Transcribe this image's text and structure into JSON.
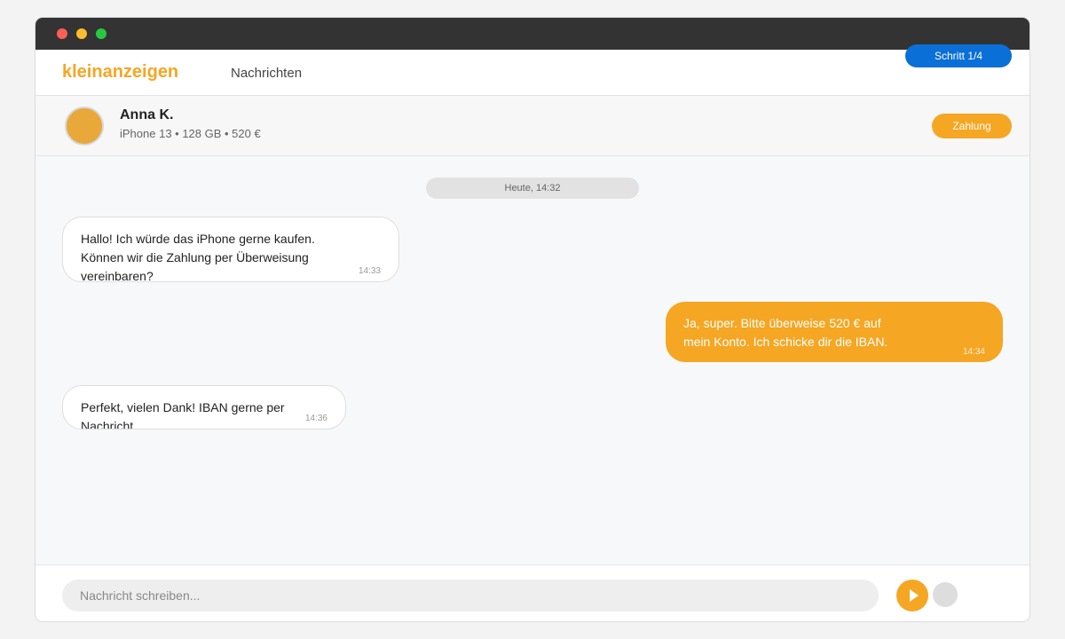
{
  "app": {
    "brand": "kleinanzeigen",
    "nav_link": "Nachrichten",
    "step_label": "Schritt 1/4"
  },
  "chat": {
    "contact_name": "Anna K.",
    "contact_sub": "iPhone 13 • 128 GB • 520 €",
    "pay_label": "Zahlung",
    "date_label": "Heute, 14:32",
    "messages": [
      {
        "direction": "incoming",
        "text": "Hallo! Ich würde das iPhone gerne kaufen.\nKönnen wir die Zahlung per Überweisung\nvereinbaren?",
        "time": "14:33"
      },
      {
        "direction": "outgoing",
        "text": "Ja, super. Bitte überweise 520 € auf\nmein Konto. Ich schicke dir die IBAN.",
        "time": "14:34"
      },
      {
        "direction": "incoming",
        "text": "Perfekt, vielen Dank! IBAN gerne per\nNachricht.",
        "time": "14:36"
      }
    ]
  },
  "composer": {
    "placeholder": "Nachricht schreiben...",
    "value": "",
    "send_icon": "play-icon",
    "attach_icon": "circle-icon"
  },
  "colors": {
    "accent": "#f5a623",
    "step_badge": "#0a6fd6",
    "titlebar": "#333333"
  }
}
